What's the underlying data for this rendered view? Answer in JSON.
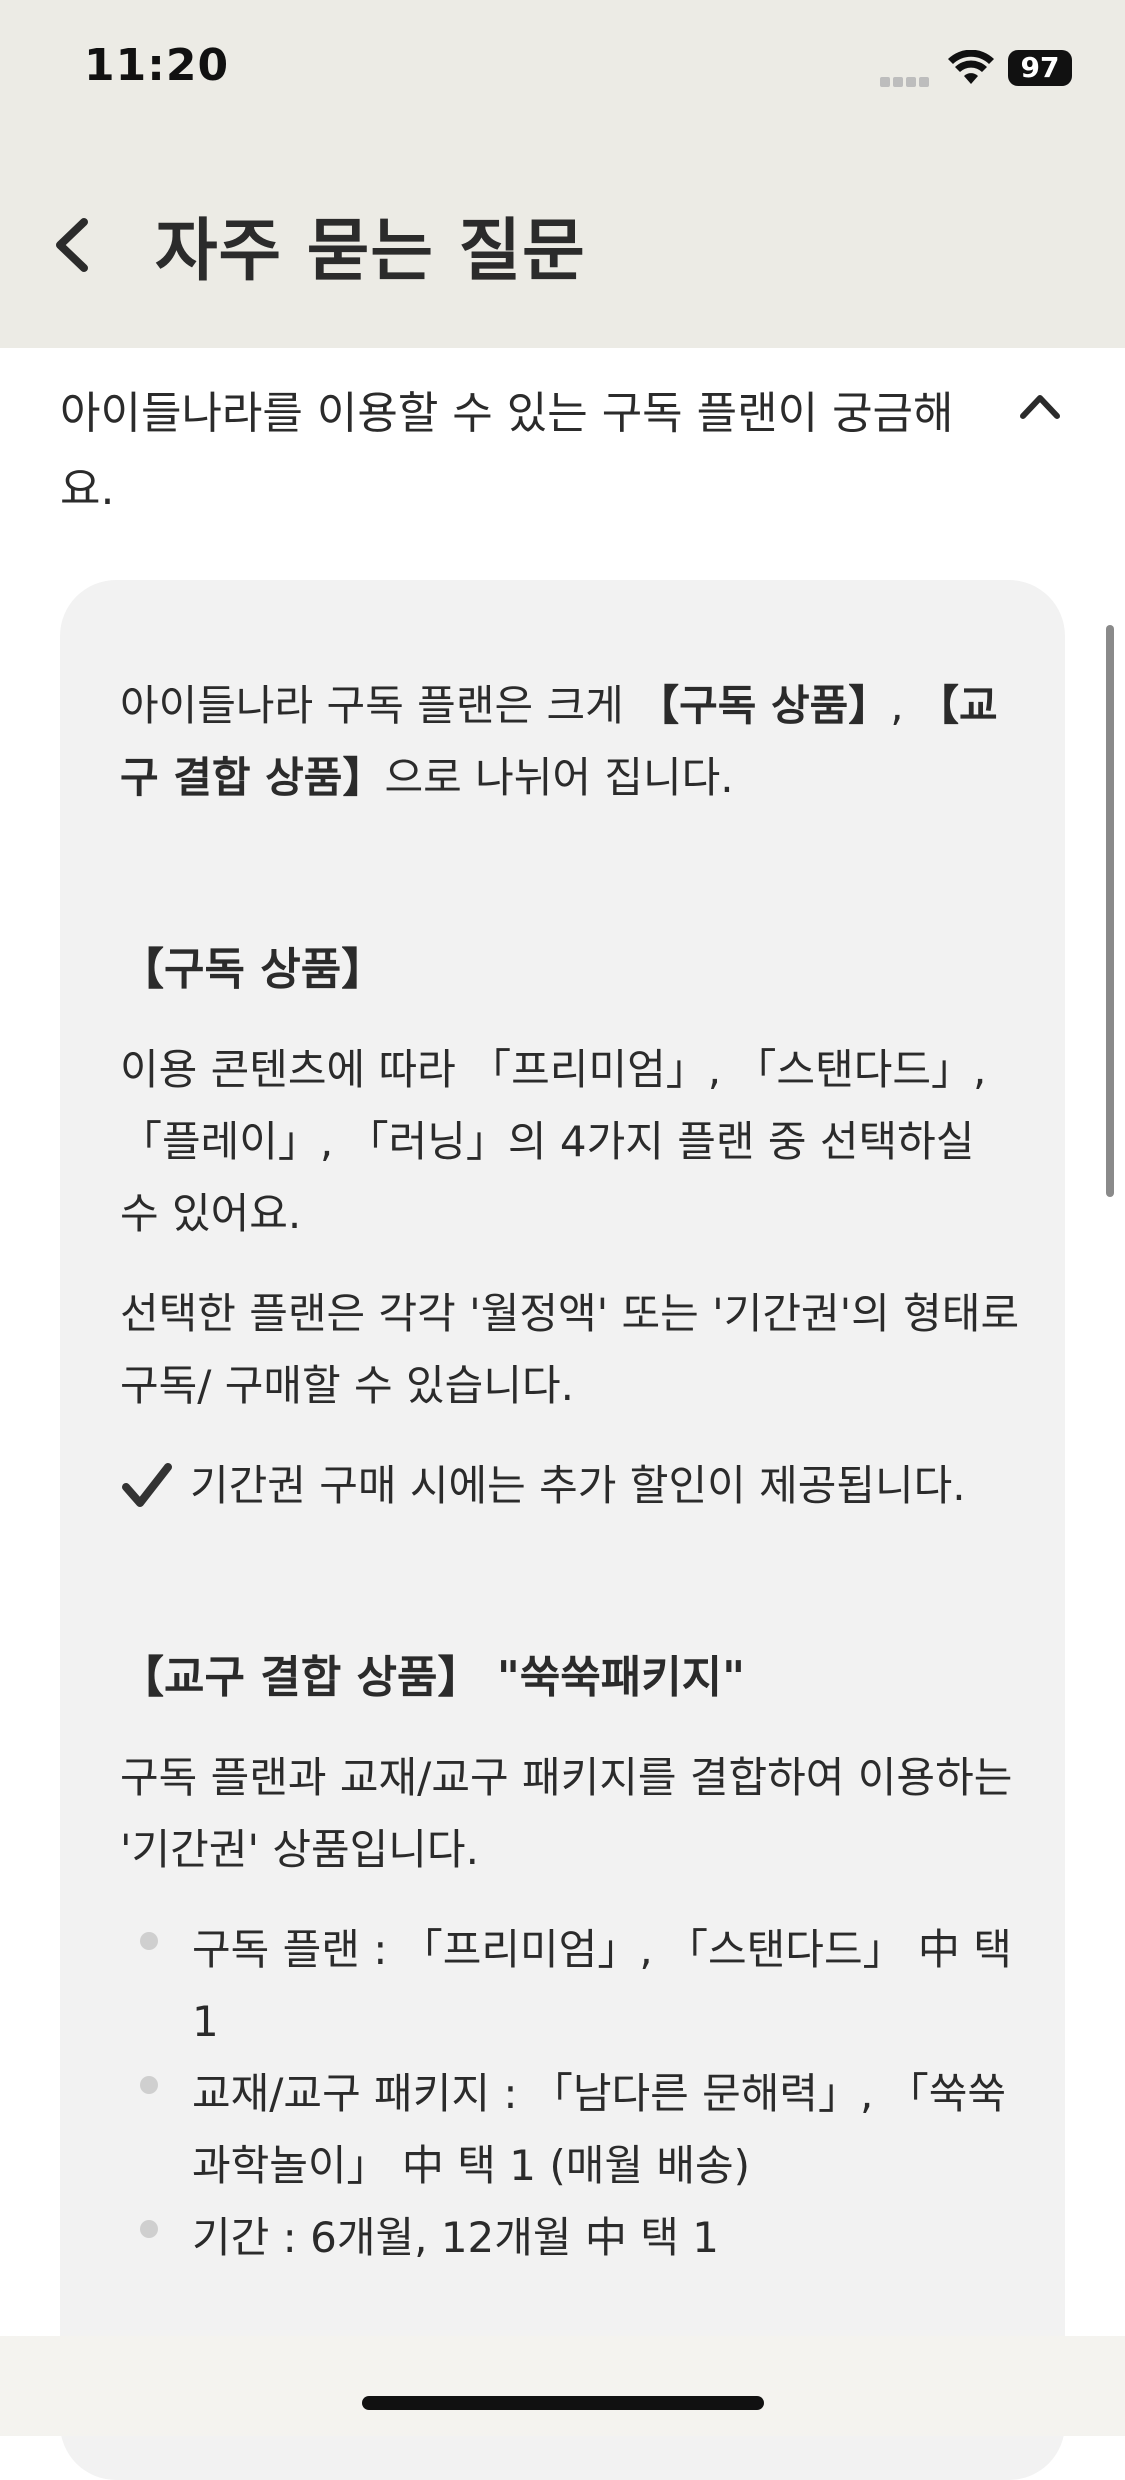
{
  "status_bar": {
    "time": "11:20",
    "battery": "97",
    "icons": [
      "signal-icon",
      "wifi-icon",
      "battery-icon"
    ]
  },
  "header": {
    "title": "자주 묻는 질문",
    "back_icon": "chevron-left-icon"
  },
  "faq": {
    "question": "아이들나라를 이용할 수 있는 구독 플랜이 궁금해요.",
    "toggle_icon": "chevron-up-icon",
    "answer": {
      "intro_prefix": "아이들나라 구독 플랜은 크게 ",
      "intro_bold1": "【구독 상품】",
      "intro_sep": ", ",
      "intro_bold2": "【교구 결합 상품】",
      "intro_suffix": "으로 나뉘어 집니다.",
      "section1_heading": "【구독 상품】",
      "section1_p1": "이용 콘텐츠에 따라 「프리미엄」, 「스탠다드」, 「플레이」, 「러닝」의 4가지 플랜 중 선택하실 수 있어요.",
      "section1_p2": "선택한 플랜은 각각 '월정액' 또는 '기간권'의 형태로 구독/ 구매할 수 있습니다.",
      "section1_check": "기간권 구매 시에는 추가 할인이 제공됩니다.",
      "check_icon": "checkmark-icon",
      "section2_heading": "【교구 결합 상품】 \"쑥쑥패키지\"",
      "section2_p1": "구독 플랜과 교재/교구 패키지를 결합하여 이용하는 '기간권' 상품입니다.",
      "bullets": [
        "구독 플랜 : 「프리미엄」, 「스탠다드」 中 택 1",
        "교재/교구 패키지 : 「남다른 문해력」, 「쑥쑥 과학놀이」 中 택 1 (매월 배송)",
        "기간 : 6개월, 12개월 中 택 1"
      ]
    }
  },
  "colors": {
    "header_bg": "#ecebe5",
    "card_bg": "#f2f2f2",
    "text": "#2b2b2b"
  }
}
